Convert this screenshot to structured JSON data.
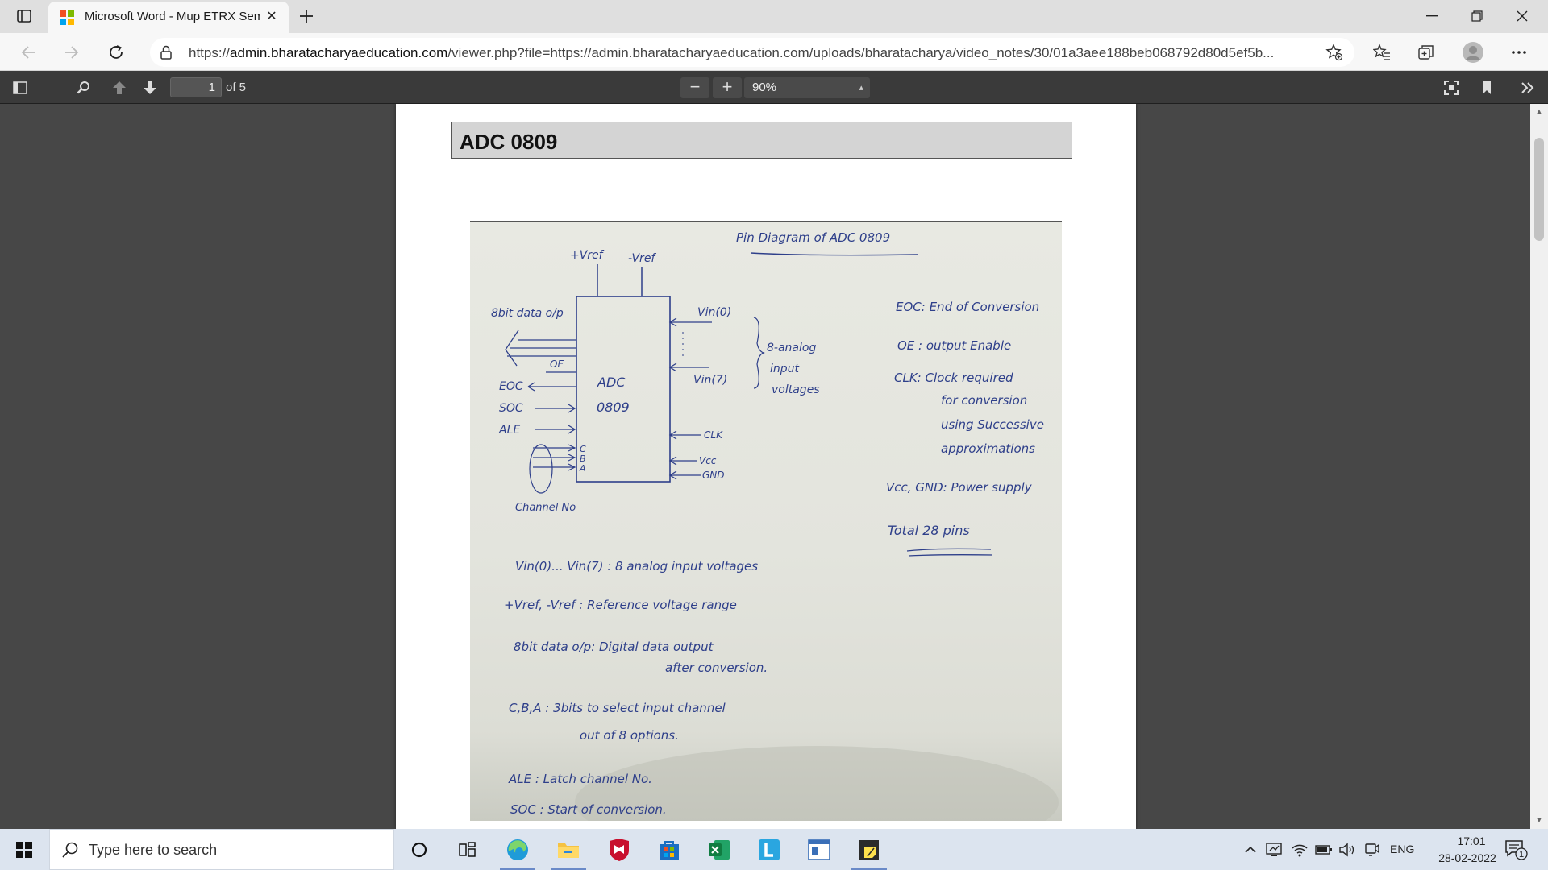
{
  "browser": {
    "tab": {
      "title": "Microsoft Word - Mup ETRX Sem"
    },
    "address_bar": {
      "url_scheme": "https://",
      "url_host": "admin.bharatacharyaeducation.com",
      "url_rest": "/viewer.php?file=https://admin.bharatacharyaeducation.com/uploads/bharatacharya/video_notes/30/01a3aee188beb068792d80d5ef5b..."
    }
  },
  "pdf_viewer": {
    "current_page": "1",
    "total_pages": "of 5",
    "zoom": "90%",
    "document": {
      "heading": "ADC 0809",
      "diagram": {
        "title": "Pin Diagram of ADC 0809",
        "chip_label_1": "ADC",
        "chip_label_2": "0809",
        "top_pins": [
          "+Vref",
          "-Vref"
        ],
        "left_pins": [
          "8bit data o/p",
          "OE",
          "EOC",
          "SOC",
          "ALE",
          "C",
          "B",
          "A",
          "Channel No"
        ],
        "right_pins": [
          "Vin(0)",
          "Vin(7)",
          "CLK",
          "Vcc",
          "GND"
        ],
        "analog_note": [
          "8-analog",
          "input",
          "voltages"
        ],
        "legend": [
          "EOC: End of Conversion",
          "OE : output Enable",
          "CLK: Clock required",
          "for conversion",
          "using Successive",
          "approximations",
          "Vcc, GND: Power supply",
          "Total 28 pins"
        ],
        "notes": [
          "Vin(0)... Vin(7) : 8 analog input voltages",
          "+Vref, -Vref : Reference voltage range",
          "8bit data o/p: Digital data output",
          "after conversion.",
          "C,B,A : 3bits to select input channel",
          "out of 8 options.",
          "ALE : Latch channel No.",
          "SOC : Start of conversion."
        ]
      }
    }
  },
  "taskbar": {
    "search_placeholder": "Type here to search",
    "language": "ENG",
    "time": "17:01",
    "date": "28-02-2022",
    "notification_count": "1"
  }
}
